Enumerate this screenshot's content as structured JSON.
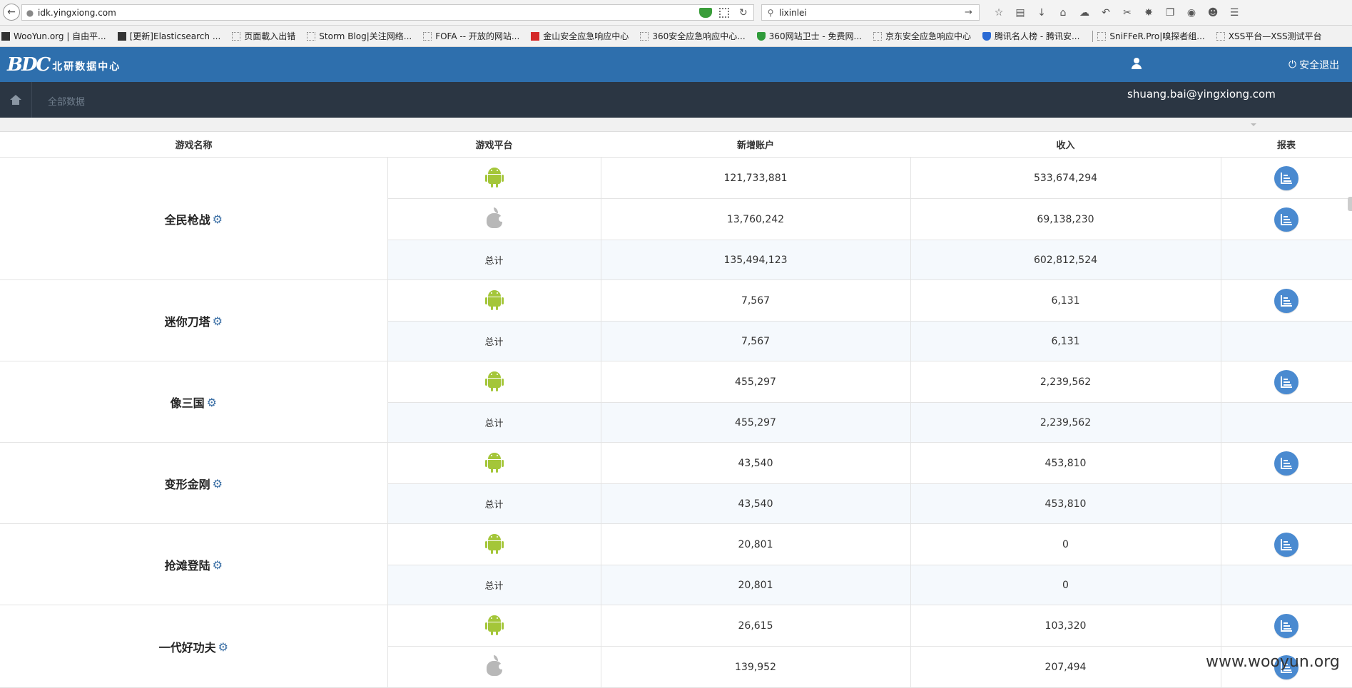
{
  "browser": {
    "url": "idk.yingxiong.com",
    "search_value": "lixinlei",
    "bookmarks": [
      {
        "label": "WooYun.org | 自由平...",
        "icon": "dark"
      },
      {
        "label": "[更新]Elasticsearch ...",
        "icon": "dark"
      },
      {
        "label": "页面載入出错",
        "icon": "dotted"
      },
      {
        "label": "Storm Blog|关注网络...",
        "icon": "dotted"
      },
      {
        "label": "FOFA -- 开放的网站...",
        "icon": "dotted"
      },
      {
        "label": "金山安全应急响应中心",
        "icon": "red"
      },
      {
        "label": "360安全应急响应中心...",
        "icon": "dotted"
      },
      {
        "label": "360网站卫士 - 免费网...",
        "icon": "green"
      },
      {
        "label": "京东安全应急响应中心",
        "icon": "dotted"
      },
      {
        "label": "腾讯名人榜 - 腾讯安...",
        "icon": "blue"
      },
      {
        "label": "SniFFeR.Pro|嗅探者组...",
        "icon": "dotted"
      },
      {
        "label": "XSS平台—XSS测试平台",
        "icon": "dotted"
      }
    ]
  },
  "header": {
    "logo_mark": "BDC",
    "logo_text": "北研数据中心",
    "logout_label": "安全退出"
  },
  "subnav": {
    "all_data": "全部数据",
    "user_email": "shuang.bai@yingxiong.com"
  },
  "table": {
    "headers": {
      "game": "游戏名称",
      "platform": "游戏平台",
      "new_accounts": "新增账户",
      "revenue": "收入",
      "report": "报表"
    },
    "games": [
      {
        "name": "全民枪战",
        "rows": [
          {
            "platform": "android",
            "new_accounts": "121,733,881",
            "revenue": "533,674,294"
          },
          {
            "platform": "apple",
            "new_accounts": "13,760,242",
            "revenue": "69,138,230"
          },
          {
            "platform": "total",
            "label": "总计",
            "new_accounts": "135,494,123",
            "revenue": "602,812,524"
          }
        ]
      },
      {
        "name": "迷你刀塔",
        "rows": [
          {
            "platform": "android",
            "new_accounts": "7,567",
            "revenue": "6,131"
          },
          {
            "platform": "total",
            "label": "总计",
            "new_accounts": "7,567",
            "revenue": "6,131"
          }
        ]
      },
      {
        "name": "像三国",
        "rows": [
          {
            "platform": "android",
            "new_accounts": "455,297",
            "revenue": "2,239,562"
          },
          {
            "platform": "total",
            "label": "总计",
            "new_accounts": "455,297",
            "revenue": "2,239,562"
          }
        ]
      },
      {
        "name": "变形金刚",
        "rows": [
          {
            "platform": "android",
            "new_accounts": "43,540",
            "revenue": "453,810"
          },
          {
            "platform": "total",
            "label": "总计",
            "new_accounts": "43,540",
            "revenue": "453,810"
          }
        ]
      },
      {
        "name": "抢滩登陆",
        "rows": [
          {
            "platform": "android",
            "new_accounts": "20,801",
            "revenue": "0"
          },
          {
            "platform": "total",
            "label": "总计",
            "new_accounts": "20,801",
            "revenue": "0"
          }
        ]
      },
      {
        "name": "一代好功夫",
        "rows": [
          {
            "platform": "android",
            "new_accounts": "26,615",
            "revenue": "103,320"
          },
          {
            "platform": "apple",
            "new_accounts": "139,952",
            "revenue": "207,494"
          }
        ]
      }
    ]
  },
  "watermark": "www.wooyun.org",
  "colors": {
    "header_blue": "#2e6fad",
    "subnav_dark": "#2b3643",
    "report_button": "#4a8ad0",
    "android_green": "#a4c639"
  }
}
